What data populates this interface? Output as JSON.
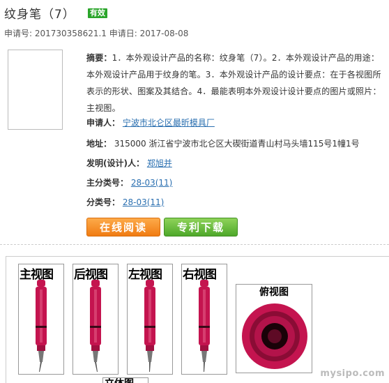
{
  "header": {
    "title": "纹身笔（7）",
    "status_badge": "有效",
    "meta": "申请号: 201730358621.1 申请日: 2017-08-08"
  },
  "details": {
    "abstract_label": "摘要：",
    "abstract_text": "1．本外观设计产品的名称：纹身笔（7）。2．本外观设计产品的用途：本外观设计产品用于纹身的笔。3．本外观设计产品的设计要点：在于各视图所表示的形状、图案及其结合。4．最能表明本外观设计设计要点的图片或照片：主视图。",
    "applicant_label": "申请人：",
    "applicant_value": "宁波市北仑区最昕模具厂",
    "address_label": "地址：",
    "address_value": "315000 浙江省宁波市北仑区大碶街道青山村马头墙115号1幢1号",
    "inventor_label": "发明(设计)人：",
    "inventor_value": "郑旭并",
    "main_class_label": "主分类号：",
    "main_class_value": "28-03(11)",
    "class_label": "分类号：",
    "class_value": "28-03(11)"
  },
  "actions": {
    "read_online": "在线阅读",
    "patent_download": "专利下载"
  },
  "views": {
    "front": "主视图",
    "back": "后视图",
    "left": "左视图",
    "right": "右视图",
    "top": "俯视图",
    "bottom_partial": "立体图"
  },
  "watermark": "mysipo.com",
  "colors": {
    "pen_body": "#c4144f",
    "link": "#2a6fb0",
    "badge": "#2aa52a",
    "btn_orange": "#f07b12",
    "btn_green": "#4ea82a"
  }
}
